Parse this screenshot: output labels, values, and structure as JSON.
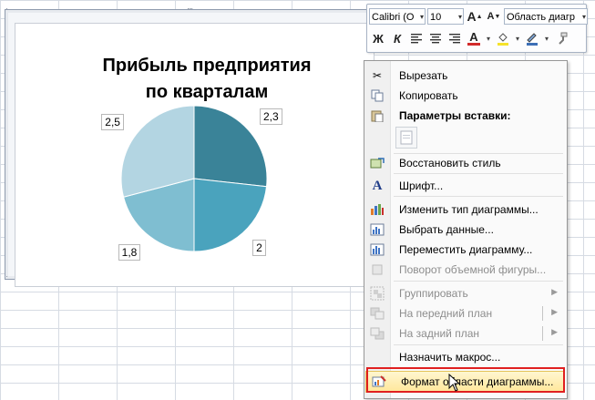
{
  "chart": {
    "title": "Прибыль предприятия по кварталам"
  },
  "chart_data": {
    "type": "pie",
    "title": "Прибыль предприятия по кварталам",
    "categories": [
      "",
      "",
      "",
      ""
    ],
    "values": [
      2.3,
      2,
      1.8,
      2.5
    ],
    "value_labels": [
      "2,3",
      "2",
      "1,8",
      "2,5"
    ],
    "colors": [
      "#3a8398",
      "#4aa3bd",
      "#7fbed1",
      "#b3d5e2"
    ]
  },
  "mini_toolbar": {
    "font_name": "Calibri (О",
    "font_size": "10",
    "grow_font": "A",
    "shrink_font": "A",
    "element_select": "Область диагр",
    "bold": "Ж",
    "italic": "К",
    "font_color": "A"
  },
  "context_menu": {
    "items": [
      {
        "label": "Вырезать",
        "icon": "scissors-icon",
        "enabled": true
      },
      {
        "label": "Копировать",
        "icon": "copy-icon",
        "enabled": true
      },
      {
        "label": "Параметры вставки:",
        "icon": "paste-icon",
        "enabled": true
      },
      {
        "label": "Восстановить стиль",
        "icon": "reset-style-icon",
        "enabled": true
      },
      {
        "label": "Шрифт...",
        "icon": "font-icon",
        "enabled": true
      },
      {
        "label": "Изменить тип диаграммы...",
        "icon": "chart-type-icon",
        "enabled": true
      },
      {
        "label": "Выбрать данные...",
        "icon": "select-data-icon",
        "enabled": true
      },
      {
        "label": "Переместить диаграмму...",
        "icon": "move-chart-icon",
        "enabled": true
      },
      {
        "label": "Поворот объемной фигуры...",
        "icon": "rotate-3d-icon",
        "enabled": false
      },
      {
        "label": "Группировать",
        "icon": "group-icon",
        "enabled": false
      },
      {
        "label": "На передний план",
        "icon": "bring-forward-icon",
        "enabled": false
      },
      {
        "label": "На задний план",
        "icon": "send-backward-icon",
        "enabled": false
      },
      {
        "label": "Назначить макрос...",
        "icon": "",
        "enabled": true
      },
      {
        "label": "Формат области диаграммы...",
        "icon": "format-chart-area-icon",
        "enabled": true
      }
    ]
  }
}
